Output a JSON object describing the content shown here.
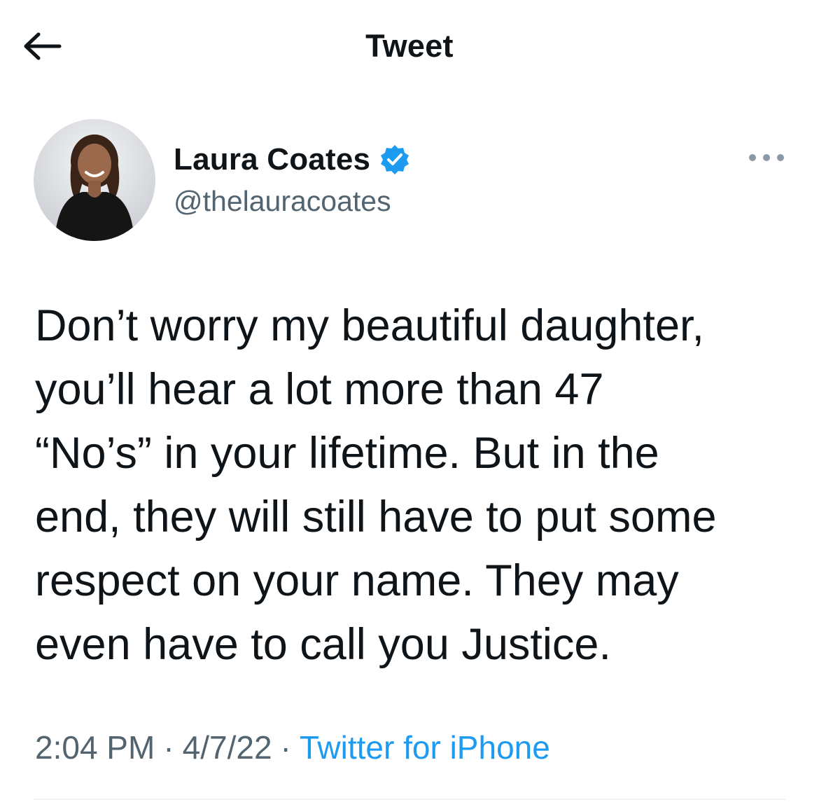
{
  "header": {
    "title": "Tweet",
    "back_icon": "arrow-left-icon"
  },
  "author": {
    "display_name": "Laura Coates",
    "handle": "@thelauracoates",
    "verified": true,
    "verified_icon": "verified-badge-icon",
    "avatar_icon": "avatar-photo"
  },
  "more_icon": "more-horizontal-icon",
  "tweet": {
    "text": "Don’t worry my beautiful daughter,\nyou’ll hear a lot more than 47\n“No’s” in your lifetime. But in the\nend, they will still have to put some\nrespect on your name. They may\neven have to call you Justice."
  },
  "meta": {
    "time": "2:04 PM",
    "separator": "·",
    "date": "4/7/22",
    "source": "Twitter for iPhone"
  },
  "colors": {
    "text_primary": "#0f1419",
    "text_secondary": "#536471",
    "accent": "#1d9bf0",
    "divider": "#eff3f4"
  }
}
